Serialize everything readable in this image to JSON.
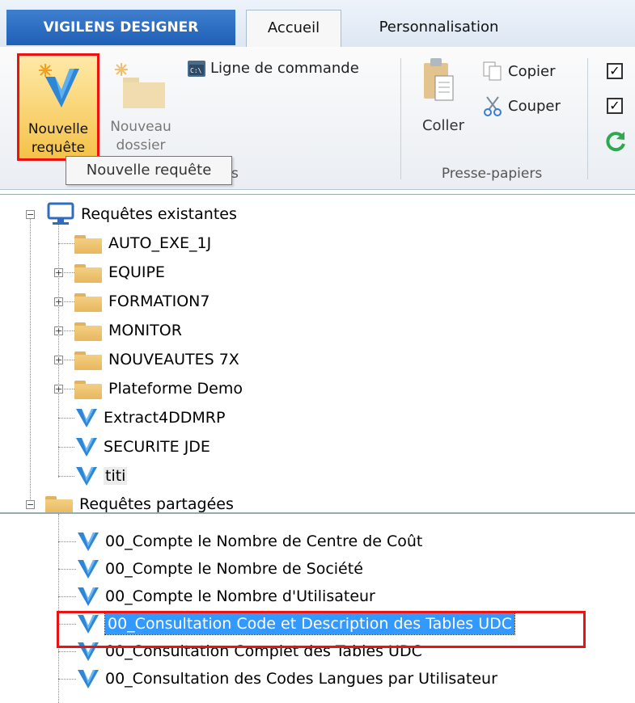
{
  "ribbon": {
    "app_tab": "VIGILENS DESIGNER",
    "tabs": [
      {
        "label": "Accueil"
      },
      {
        "label": "Personnalisation"
      }
    ],
    "buttons": {
      "nouvelle_requete": "Nouvelle\nrequête",
      "nouveau_dossier": "Nouveau\ndossier",
      "ligne_commande": "Ligne de commande",
      "coller": "Coller",
      "copier": "Copier",
      "couper": "Couper"
    },
    "groups": {
      "presse_papiers": "Presse-papiers"
    },
    "tooltip": "Nouvelle requête",
    "group_partial": "s"
  },
  "tree": {
    "root1": "Requêtes existantes",
    "items1": [
      {
        "type": "folder",
        "label": "AUTO_EXE_1J",
        "expandable": false
      },
      {
        "type": "folder",
        "label": "EQUIPE",
        "expandable": true
      },
      {
        "type": "folder",
        "label": "FORMATION7",
        "expandable": true
      },
      {
        "type": "folder",
        "label": "MONITOR",
        "expandable": true
      },
      {
        "type": "folder",
        "label": "NOUVEAUTES 7X",
        "expandable": true
      },
      {
        "type": "folder",
        "label": "Plateforme Demo",
        "expandable": true
      },
      {
        "type": "query",
        "label": "Extract4DDMRP"
      },
      {
        "type": "query",
        "label": "SECURITE JDE"
      },
      {
        "type": "query",
        "label": "titi"
      }
    ],
    "root2": "Requêtes partagées",
    "items2": [
      {
        "label": "00_Compte le Nombre de Centre de Coût"
      },
      {
        "label": "00_Compte le Nombre de Société"
      },
      {
        "label": "00_Compte le Nombre d'Utilisateur"
      },
      {
        "label": "00_Consultation Code et Description des Tables UDC"
      },
      {
        "label": "00_Consultation Complet des Tables UDC"
      },
      {
        "label": "00_Consultation des Codes Langues par Utilisateur"
      }
    ]
  },
  "colors": {
    "accent": "#3399ff",
    "highlight": "#ee1111",
    "brand": "#1f5fb5"
  }
}
